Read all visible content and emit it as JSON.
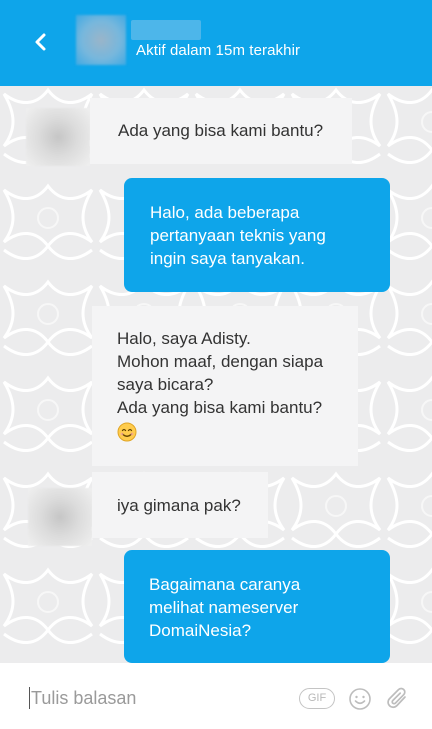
{
  "header": {
    "back_icon": "chevron-left-icon",
    "status": "Aktif dalam 15m terakhir",
    "background": "#0ea5ea"
  },
  "messages": [
    {
      "direction": "incoming",
      "lines": [
        "Ada yang bisa kami bantu?"
      ]
    },
    {
      "direction": "outgoing",
      "lines": [
        "Halo, ada beberapa",
        "pertanyaan teknis yang",
        "ingin saya tanyakan."
      ]
    },
    {
      "direction": "incoming",
      "lines": [
        "Halo, saya Adisty.",
        "Mohon maaf, dengan siapa",
        "saya bicara?",
        "Ada yang bisa kami bantu?"
      ],
      "emoji": "smiling-face-emoji"
    },
    {
      "direction": "incoming",
      "lines": [
        "iya gimana pak?"
      ]
    },
    {
      "direction": "outgoing",
      "lines": [
        "Bagaimana caranya",
        "melihat nameserver",
        "DomaiNesia?"
      ]
    }
  ],
  "composer": {
    "placeholder": "Tulis balasan",
    "gif_label": "GIF",
    "emoji_icon": "smiley-icon",
    "attach_icon": "paperclip-icon"
  },
  "colors": {
    "accent": "#0ea5ea",
    "incoming_bubble": "#f4f4f5",
    "chat_background": "#ececed"
  }
}
